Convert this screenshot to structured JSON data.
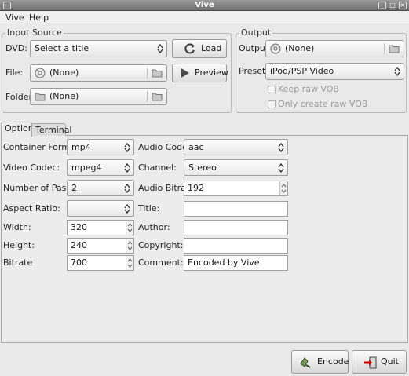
{
  "window": {
    "title": "Vive"
  },
  "menu": {
    "items": [
      "Vive",
      "Help"
    ]
  },
  "input_source": {
    "legend": "Input Source",
    "dvd_label": "DVD:",
    "dvd_value": "Select a title",
    "file_label": "File:",
    "file_value": "(None)",
    "folder_label": "Folder:",
    "folder_value": "(None)",
    "load_label": "Load",
    "preview_label": "Preview"
  },
  "output": {
    "legend": "Output",
    "output_label": "Output:",
    "output_value": "(None)",
    "preset_label": "Preset:",
    "preset_value": "iPod/PSP Video",
    "keep_raw_vob": "Keep raw VOB",
    "only_raw_vob": "Only create raw VOB"
  },
  "tabs": [
    "Options",
    "Terminal"
  ],
  "options": {
    "container_format_label": "Container Format:",
    "container_format_value": "mp4",
    "video_codec_label": "Video Codec:",
    "video_codec_value": "mpeg4",
    "passes_label": "Number of Passes:",
    "passes_value": "2",
    "aspect_ratio_label": "Aspect Ratio:",
    "aspect_ratio_value": "",
    "width_label": "Width:",
    "width_value": "320",
    "height_label": "Height:",
    "height_value": "240",
    "bitrate_label": "Bitrate",
    "bitrate_value": "700",
    "audio_codec_label": "Audio Codec:",
    "audio_codec_value": "aac",
    "channel_label": "Channel:",
    "channel_value": "Stereo",
    "audio_bitrate_label": "Audio Bitrate:",
    "audio_bitrate_value": "192",
    "title_label": "Title:",
    "title_value": "",
    "author_label": "Author:",
    "author_value": "",
    "copyright_label": "Copyright:",
    "copyright_value": "",
    "comment_label": "Comment:",
    "comment_value": "Encoded by Vive"
  },
  "actions": {
    "encode_label": "Encode",
    "quit_label": "Quit"
  }
}
